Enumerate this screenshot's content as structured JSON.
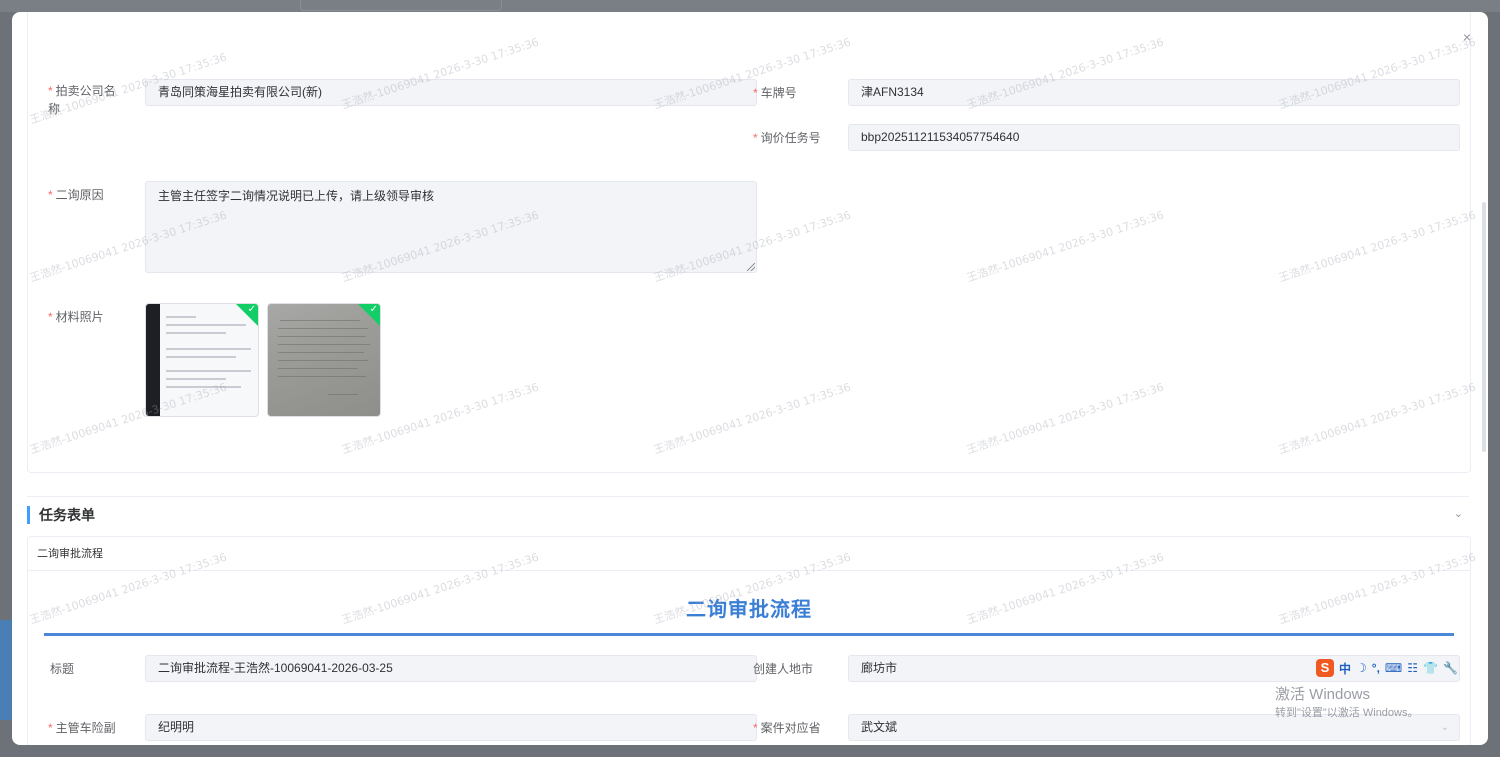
{
  "modal": {
    "close_label": "×"
  },
  "form_top": {
    "company": {
      "label": "拍卖公司名称",
      "value": "青岛同策海星拍卖有限公司(新)"
    },
    "plate": {
      "label": "车牌号",
      "value": "津AFN3134"
    },
    "inquiry_task": {
      "label": "询价任务号",
      "value": "bbp20251121153405775464​0"
    },
    "reason": {
      "label": "二询原因",
      "value": "主管主任签字二询情况说明已上传，请上级领导审核"
    },
    "photos": {
      "label": "材料照片",
      "count": 2
    }
  },
  "section": {
    "title": "任务表单",
    "chevron": "⌄"
  },
  "task_form": {
    "header": "二询审批流程",
    "title": "二询审批流程",
    "fields": {
      "subject": {
        "label": "标题",
        "value": "二询审批流程-王浩然-10069041-2026-03-25"
      },
      "creator_city": {
        "label": "创建人地市",
        "value": "廊坊市"
      },
      "supervisor": {
        "label": "主管车险副",
        "value": "纪明明"
      },
      "case_province": {
        "label": "案件对应省",
        "value": "武文斌"
      }
    }
  },
  "watermark": {
    "text": "王浩然-10069041  2026-3-30 17:35:36"
  },
  "ime": {
    "lang": "中",
    "icons": [
      "moon-icon",
      "punctuation-icon",
      "keyboard-icon",
      "toolbox-icon",
      "skin-icon",
      "wrench-icon"
    ]
  },
  "os_overlay": {
    "line1": "激活 Windows",
    "line2": "转到\"设置\"以激活 Windows。"
  },
  "colors": {
    "accent": "#409eff",
    "required": "#f56c6c",
    "title_blue": "#3a7fd5",
    "success": "#13ce66"
  }
}
